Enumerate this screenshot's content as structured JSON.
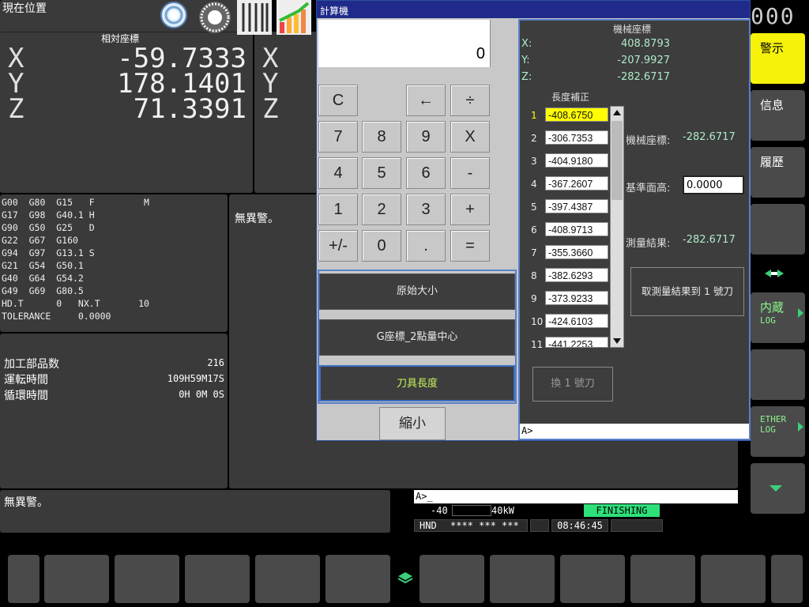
{
  "position_panel": {
    "title": "現在位置",
    "relative_label": "相対座標",
    "axes": [
      "X",
      "Y",
      "Z"
    ],
    "values": [
      "-59.7333",
      "178.1401",
      "71.3391"
    ],
    "right_axes": [
      "X",
      "Y",
      "Z"
    ]
  },
  "top_icons": [
    "ring-icon",
    "spindle-icon",
    "tools-icon",
    "growth-chart-icon"
  ],
  "top_right_counter": "000",
  "gcode_lines": [
    "G00  G80  G15   F         M",
    "G17  G98  G40.1 H",
    "G90  G50  G25   D",
    "G22  G67  G160",
    "G94  G97  G13.1 S",
    "G21  G54  G50.1",
    "G40  G64  G54.2",
    "G49  G69  G80.5",
    "HD.T      0   NX.T       10",
    "TOLERANCE     0.0000"
  ],
  "alarm_center": "無異警。",
  "counters": {
    "parts_label": "加工部品数",
    "parts_value": "216",
    "run_label": "運転時間",
    "run_value": "109H59M17S",
    "cycle_label": "循環時間",
    "cycle_value": "0H 0M 0S"
  },
  "bottom_alarm": "無異警。",
  "status": {
    "prompt": "A>_",
    "load_left": "-40",
    "load_right": "40kW",
    "finishing": "FINISHING",
    "mode": "HND",
    "stars": "**** *** ***",
    "time": "08:46:45"
  },
  "side_buttons": {
    "alarm": "警示",
    "info": "信息",
    "history": "履歷",
    "builtin_log": "内蔵",
    "builtin_log_sub": "LOG",
    "ether_log": "ETHER",
    "ether_log_sub": "LOG"
  },
  "calculator": {
    "title": "計算機",
    "display": "0",
    "keys": {
      "clear": "C",
      "back": "←",
      "divide": "÷",
      "k7": "7",
      "k8": "8",
      "k9": "9",
      "multiply": "X",
      "k4": "4",
      "k5": "5",
      "k6": "6",
      "minus": "-",
      "k1": "1",
      "k2": "2",
      "k3": "3",
      "plus": "+",
      "sign": "+/-",
      "k0": "0",
      "dot": ".",
      "equals": "="
    },
    "func_buttons": [
      "原始大小",
      "G座標_2點量中心",
      "刀具長度"
    ],
    "shrink": "縮小",
    "machine_coord_title": "機械座標",
    "machine_coords": [
      {
        "axis": "X:",
        "value": "408.8793"
      },
      {
        "axis": "Y:",
        "value": "-207.9927"
      },
      {
        "axis": "Z:",
        "value": "-282.6717"
      }
    ],
    "tool_length_title": "長度補正",
    "tool_lengths": [
      {
        "no": "1",
        "value": "-408.6750"
      },
      {
        "no": "2",
        "value": "-306.7353"
      },
      {
        "no": "3",
        "value": "-404.9180"
      },
      {
        "no": "4",
        "value": "-367.2607"
      },
      {
        "no": "5",
        "value": "-397.4387"
      },
      {
        "no": "6",
        "value": "-408.9713"
      },
      {
        "no": "7",
        "value": "-355.3660"
      },
      {
        "no": "8",
        "value": "-382.6293"
      },
      {
        "no": "9",
        "value": "-373.9233"
      },
      {
        "no": "10",
        "value": "-424.6103"
      },
      {
        "no": "11",
        "value": "-441.2253"
      }
    ],
    "mech_coord_label": "機械座標:",
    "mech_coord_value": "-282.6717",
    "ref_height_label": "基準面高:",
    "ref_height_value": "0.0000",
    "measure_label": "測量結果:",
    "measure_value": "-282.6717",
    "take_result_button": "取測量結果到 1 號刀",
    "swap_button": "換 1 號刀",
    "prompt": "A>"
  },
  "colors": {
    "alarm_yellow": "#ffff00",
    "finishing_green": "#2ee07a",
    "title_blue": "#1f2a8a",
    "highlight_yellow": "#ffff00"
  }
}
